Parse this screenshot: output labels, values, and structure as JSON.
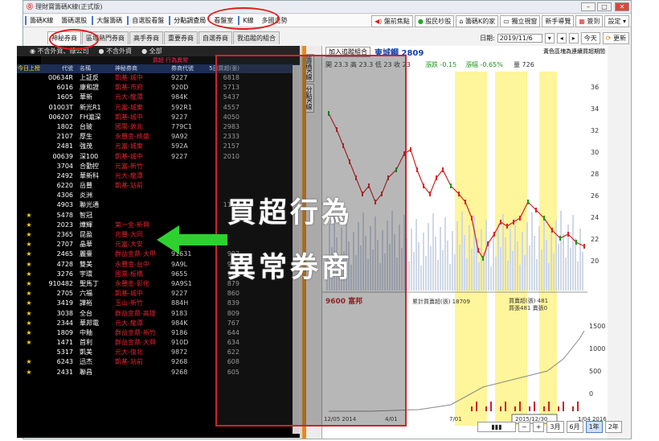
{
  "window": {
    "title": "理財寶籌碼K線(正式版)"
  },
  "toolbar": {
    "items": [
      "籌碼K線",
      "籌碼選股",
      "大盤籌碼",
      "自選股看盤",
      "分點調查局",
      "看盤室",
      "K線",
      "多國走勢"
    ],
    "right_buttons": [
      "盤前焦點",
      "股民吵股",
      "籌碼K的家",
      "獨立視窗",
      "新手導覽",
      "簽到",
      "設定"
    ]
  },
  "tabs": [
    "神秘券商",
    "區域熱門券商",
    "高手券商",
    "重要券商",
    "自選券商",
    "我追蹤的組合"
  ],
  "date": {
    "label": "日期:",
    "value": "2019/11/6",
    "today": "今天",
    "refresh": "更新"
  },
  "filters": [
    "不含外資、綠公司",
    "不含外資",
    "全部"
  ],
  "table": {
    "caption": "買超 行為異常",
    "headers": [
      "今日上榜",
      "代號",
      "名稱",
      "神秘券商",
      "券商代號",
      "5日買超(張)"
    ],
    "rows": [
      {
        "star": "",
        "code": "00634R",
        "name": "上証反",
        "broker": "凱基-城中",
        "bcode": "9227",
        "vol": "6818"
      },
      {
        "star": "",
        "code": "6016",
        "name": "康和證",
        "broker": "凱基-市府",
        "bcode": "920D",
        "vol": "5713"
      },
      {
        "star": "",
        "code": "1605",
        "name": "華新",
        "broker": "元大-龍潭",
        "bcode": "984K",
        "vol": "5437"
      },
      {
        "star": "",
        "code": "01003T",
        "name": "新光R1",
        "broker": "元富-城東",
        "bcode": "592R1",
        "vol": "4557"
      },
      {
        "star": "",
        "code": "006207",
        "name": "FH滬深",
        "broker": "凱基-城中",
        "bcode": "9227",
        "vol": "4050"
      },
      {
        "star": "",
        "code": "1802",
        "name": "台玻",
        "broker": "國票-敦北",
        "bcode": "779C1",
        "vol": "2983"
      },
      {
        "star": "",
        "code": "2107",
        "name": "厚生",
        "broker": "永豐金-桃盛",
        "bcode": "9A92",
        "vol": "2333"
      },
      {
        "star": "",
        "code": "2481",
        "name": "強茂",
        "broker": "元富-城東",
        "bcode": "592A",
        "vol": "2157"
      },
      {
        "star": "",
        "code": "00639",
        "name": "深100",
        "broker": "凱基-城中",
        "bcode": "9227",
        "vol": "2010"
      },
      {
        "star": "",
        "code": "3704",
        "name": "合勤控",
        "broker": "元富-新竹",
        "bcode": "",
        "vol": ""
      },
      {
        "star": "",
        "code": "2492",
        "name": "華新科",
        "broker": "元大-龍潭",
        "bcode": "",
        "vol": ""
      },
      {
        "star": "",
        "code": "6220",
        "name": "岳豐",
        "broker": "凱基-站前",
        "bcode": "",
        "vol": ""
      },
      {
        "star": "",
        "code": "4306",
        "name": "炎洲",
        "broker": "",
        "bcode": "",
        "vol": ""
      },
      {
        "star": "",
        "code": "4903",
        "name": "聯光通",
        "broker": "",
        "bcode": "",
        "vol": "1166"
      },
      {
        "star": "★",
        "code": "5478",
        "name": "智冠",
        "broker": "",
        "bcode": "",
        "vol": ""
      },
      {
        "star": "★",
        "code": "2023",
        "name": "燁輝",
        "broker": "第一金-新興",
        "bcode": "",
        "vol": ""
      },
      {
        "star": "★",
        "code": "2365",
        "name": "昆盈",
        "broker": "兆豐-大同",
        "bcode": "",
        "vol": ""
      },
      {
        "star": "★",
        "code": "2707",
        "name": "晶華",
        "broker": "元富-大安",
        "bcode": "",
        "vol": ""
      },
      {
        "star": "★",
        "code": "2465",
        "name": "麗臺",
        "broker": "群益金鼎-大甲",
        "bcode": "91631",
        "vol": "997"
      },
      {
        "star": "★",
        "code": "4728",
        "name": "雙美",
        "broker": "永豐金-台中",
        "bcode": "9A9L",
        "vol": "956"
      },
      {
        "star": "★",
        "code": "3276",
        "name": "宇環",
        "broker": "國票-板橋",
        "bcode": "9655",
        "vol": "915"
      },
      {
        "star": "★",
        "code": "910482",
        "name": "聖馬丁",
        "broker": "永豐金-彰化",
        "bcode": "9A9S1",
        "vol": "879"
      },
      {
        "star": "★",
        "code": "2705",
        "name": "六福",
        "broker": "凱基-城中",
        "bcode": "9227",
        "vol": "860"
      },
      {
        "star": "★",
        "code": "3419",
        "name": "譁裕",
        "broker": "玉山-新竹",
        "bcode": "884H",
        "vol": "839"
      },
      {
        "star": "★",
        "code": "3038",
        "name": "全台",
        "broker": "群益金鼎-高雄",
        "bcode": "9183",
        "vol": "809"
      },
      {
        "star": "★",
        "code": "2344",
        "name": "華邦電",
        "broker": "元大-龍潭",
        "bcode": "984K",
        "vol": "767"
      },
      {
        "star": "★",
        "code": "1809",
        "name": "中釉",
        "broker": "群益金鼎-新竹",
        "bcode": "9186",
        "vol": "644"
      },
      {
        "star": "★",
        "code": "1471",
        "name": "首利",
        "broker": "群益金鼎-大興",
        "bcode": "910D",
        "vol": "634"
      },
      {
        "star": "",
        "code": "5317",
        "name": "凱美",
        "broker": "元大-復北",
        "bcode": "9872",
        "vol": "622"
      },
      {
        "star": "★",
        "code": "6243",
        "name": "迅杰",
        "broker": "凱基-站前",
        "bcode": "9268",
        "vol": "608"
      },
      {
        "star": "★",
        "code": "2431",
        "name": "聯昌",
        "broker": "",
        "bcode": "9268",
        "vol": "605"
      }
    ]
  },
  "midbar": {
    "labels": [
      "籌碼K線",
      "分點K線"
    ]
  },
  "chart": {
    "add_button": "加入追蹤組合",
    "stock": "東城鋼 2809",
    "legend_note": "黃色區塊為連續買超期間",
    "ohlc": "開 23.3  高 23.3  低 23  收 23",
    "change": "漲跌 -0.15",
    "change_pct": "漲幅 -0.65%",
    "volume": "量 726",
    "broker_label": "9600 富邦",
    "cum_label": "累計買賣超(張) 18709",
    "buysell": "買賣超(張) 481",
    "buysell2": "買張481 賣張0",
    "price_ticks": [
      "36",
      "34",
      "32",
      "30",
      "28",
      "26",
      "24",
      "22",
      "20"
    ],
    "vol_ticks": [
      "1500",
      "1000",
      "500",
      "0"
    ],
    "x_ticks": [
      "12/05 2014",
      "4/01",
      "7/01",
      "10/01",
      "1/04 2016"
    ],
    "crosshair_date": "2015/12/30"
  },
  "bottomnav": {
    "zoomout": "−",
    "zoomin": "+",
    "periods": [
      "3月",
      "6月",
      "1年",
      "2年"
    ],
    "selected": "1年"
  },
  "overlay": {
    "line1": "買超行為",
    "line2": "異常券商"
  },
  "colors": {
    "accent": "#e21b1b",
    "arrow": "#2fd12f",
    "highlight": "#fff59a"
  }
}
